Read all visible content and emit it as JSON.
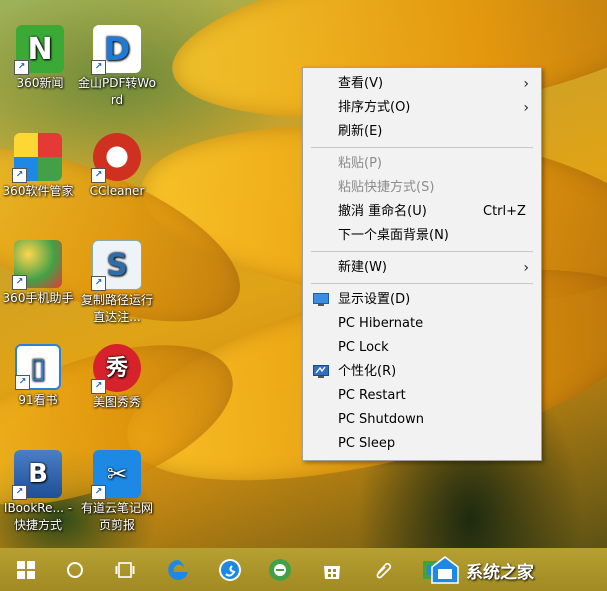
{
  "desktop_icons": [
    {
      "label": "360新闻",
      "color": "#3aa936"
    },
    {
      "label": "金山PDF转Word",
      "color": "#1f7ad6"
    },
    {
      "label": "360软件管家",
      "color": "#e04a2a"
    },
    {
      "label": "CCleaner",
      "color": "#d03020"
    },
    {
      "label": "360手机助手",
      "color": "#33aa44"
    },
    {
      "label": "复制路径运行直达注...",
      "color": "#2f6da8"
    },
    {
      "label": "91看书",
      "color": "#2a7fd6"
    },
    {
      "label": "美图秀秀",
      "color": "#d6222a"
    },
    {
      "label": "IBookRe... - 快捷方式",
      "color": "#2c5aa0"
    },
    {
      "label": "有道云笔记网页剪报",
      "color": "#1e88e5"
    }
  ],
  "context_menu": {
    "items": [
      {
        "label": "查看(V)",
        "submenu": true
      },
      {
        "label": "排序方式(O)",
        "submenu": true
      },
      {
        "label": "刷新(E)"
      },
      {
        "label": "粘贴(P)",
        "disabled": true
      },
      {
        "label": "粘贴快捷方式(S)",
        "disabled": true
      },
      {
        "label": "撤消 重命名(U)",
        "shortcut": "Ctrl+Z"
      },
      {
        "label": "下一个桌面背景(N)"
      },
      {
        "label": "新建(W)",
        "submenu": true
      },
      {
        "label": "显示设置(D)",
        "icon": "monitor-icon"
      },
      {
        "label": "PC Hibernate"
      },
      {
        "label": "PC Lock"
      },
      {
        "label": "个性化(R)",
        "icon": "personalize-icon"
      },
      {
        "label": "PC Restart"
      },
      {
        "label": "PC Shutdown"
      },
      {
        "label": "PC Sleep"
      }
    ]
  },
  "taskbar": {
    "icons": [
      "windows-start-icon",
      "cortana-icon",
      "task-view-icon",
      "edge-icon",
      "sogou-browser-icon",
      "360-browser-icon",
      "store-icon",
      "paperclip-icon",
      "app-icon"
    ]
  },
  "watermark": {
    "text": "系统之家"
  }
}
